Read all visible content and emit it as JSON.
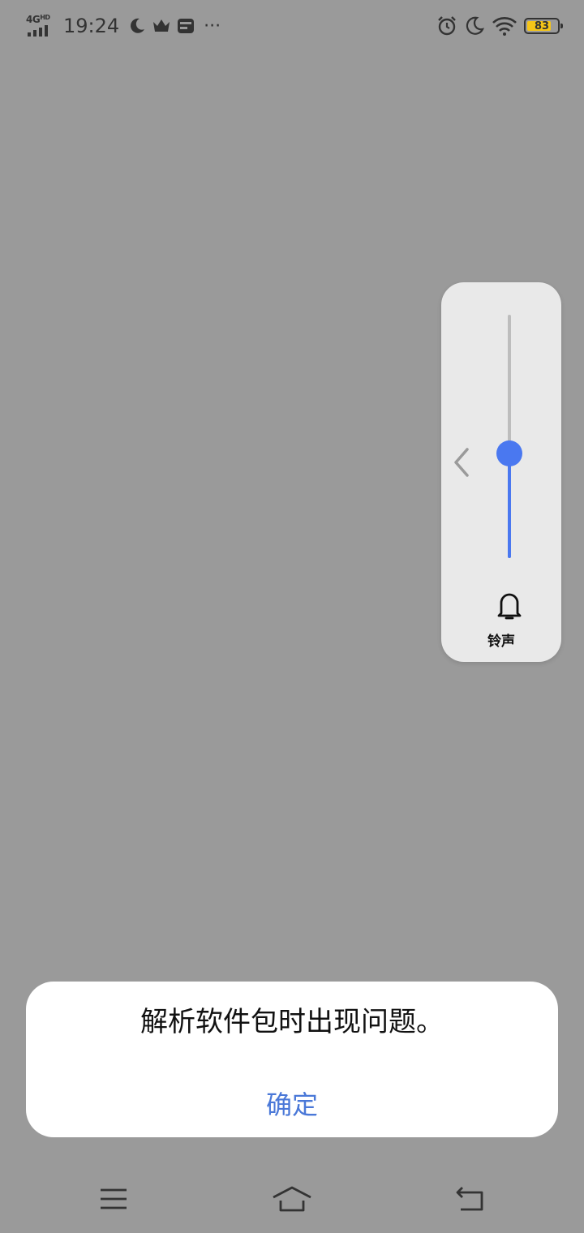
{
  "status_bar": {
    "network": "4G",
    "network_hd": "HD",
    "time": "19:24",
    "overflow": "···",
    "battery_percent": "83",
    "battery_level": 0.83,
    "battery_color": "#f5c518",
    "left_icons": [
      "signal-icon",
      "moon-icon",
      "crown-icon",
      "card-icon"
    ],
    "right_icons": [
      "alarm-icon",
      "moon-icon",
      "wifi-icon",
      "battery-icon"
    ]
  },
  "volume_panel": {
    "label": "铃声",
    "level": 0.43,
    "accent": "#4a78f0",
    "icons": [
      "chevron-left-icon",
      "bell-icon"
    ]
  },
  "dialog": {
    "message": "解析软件包时出现问题。",
    "confirm_label": "确定",
    "confirm_color": "#4a78d8"
  },
  "nav_bar": {
    "icons": [
      "menu-icon",
      "home-icon",
      "back-icon"
    ]
  }
}
